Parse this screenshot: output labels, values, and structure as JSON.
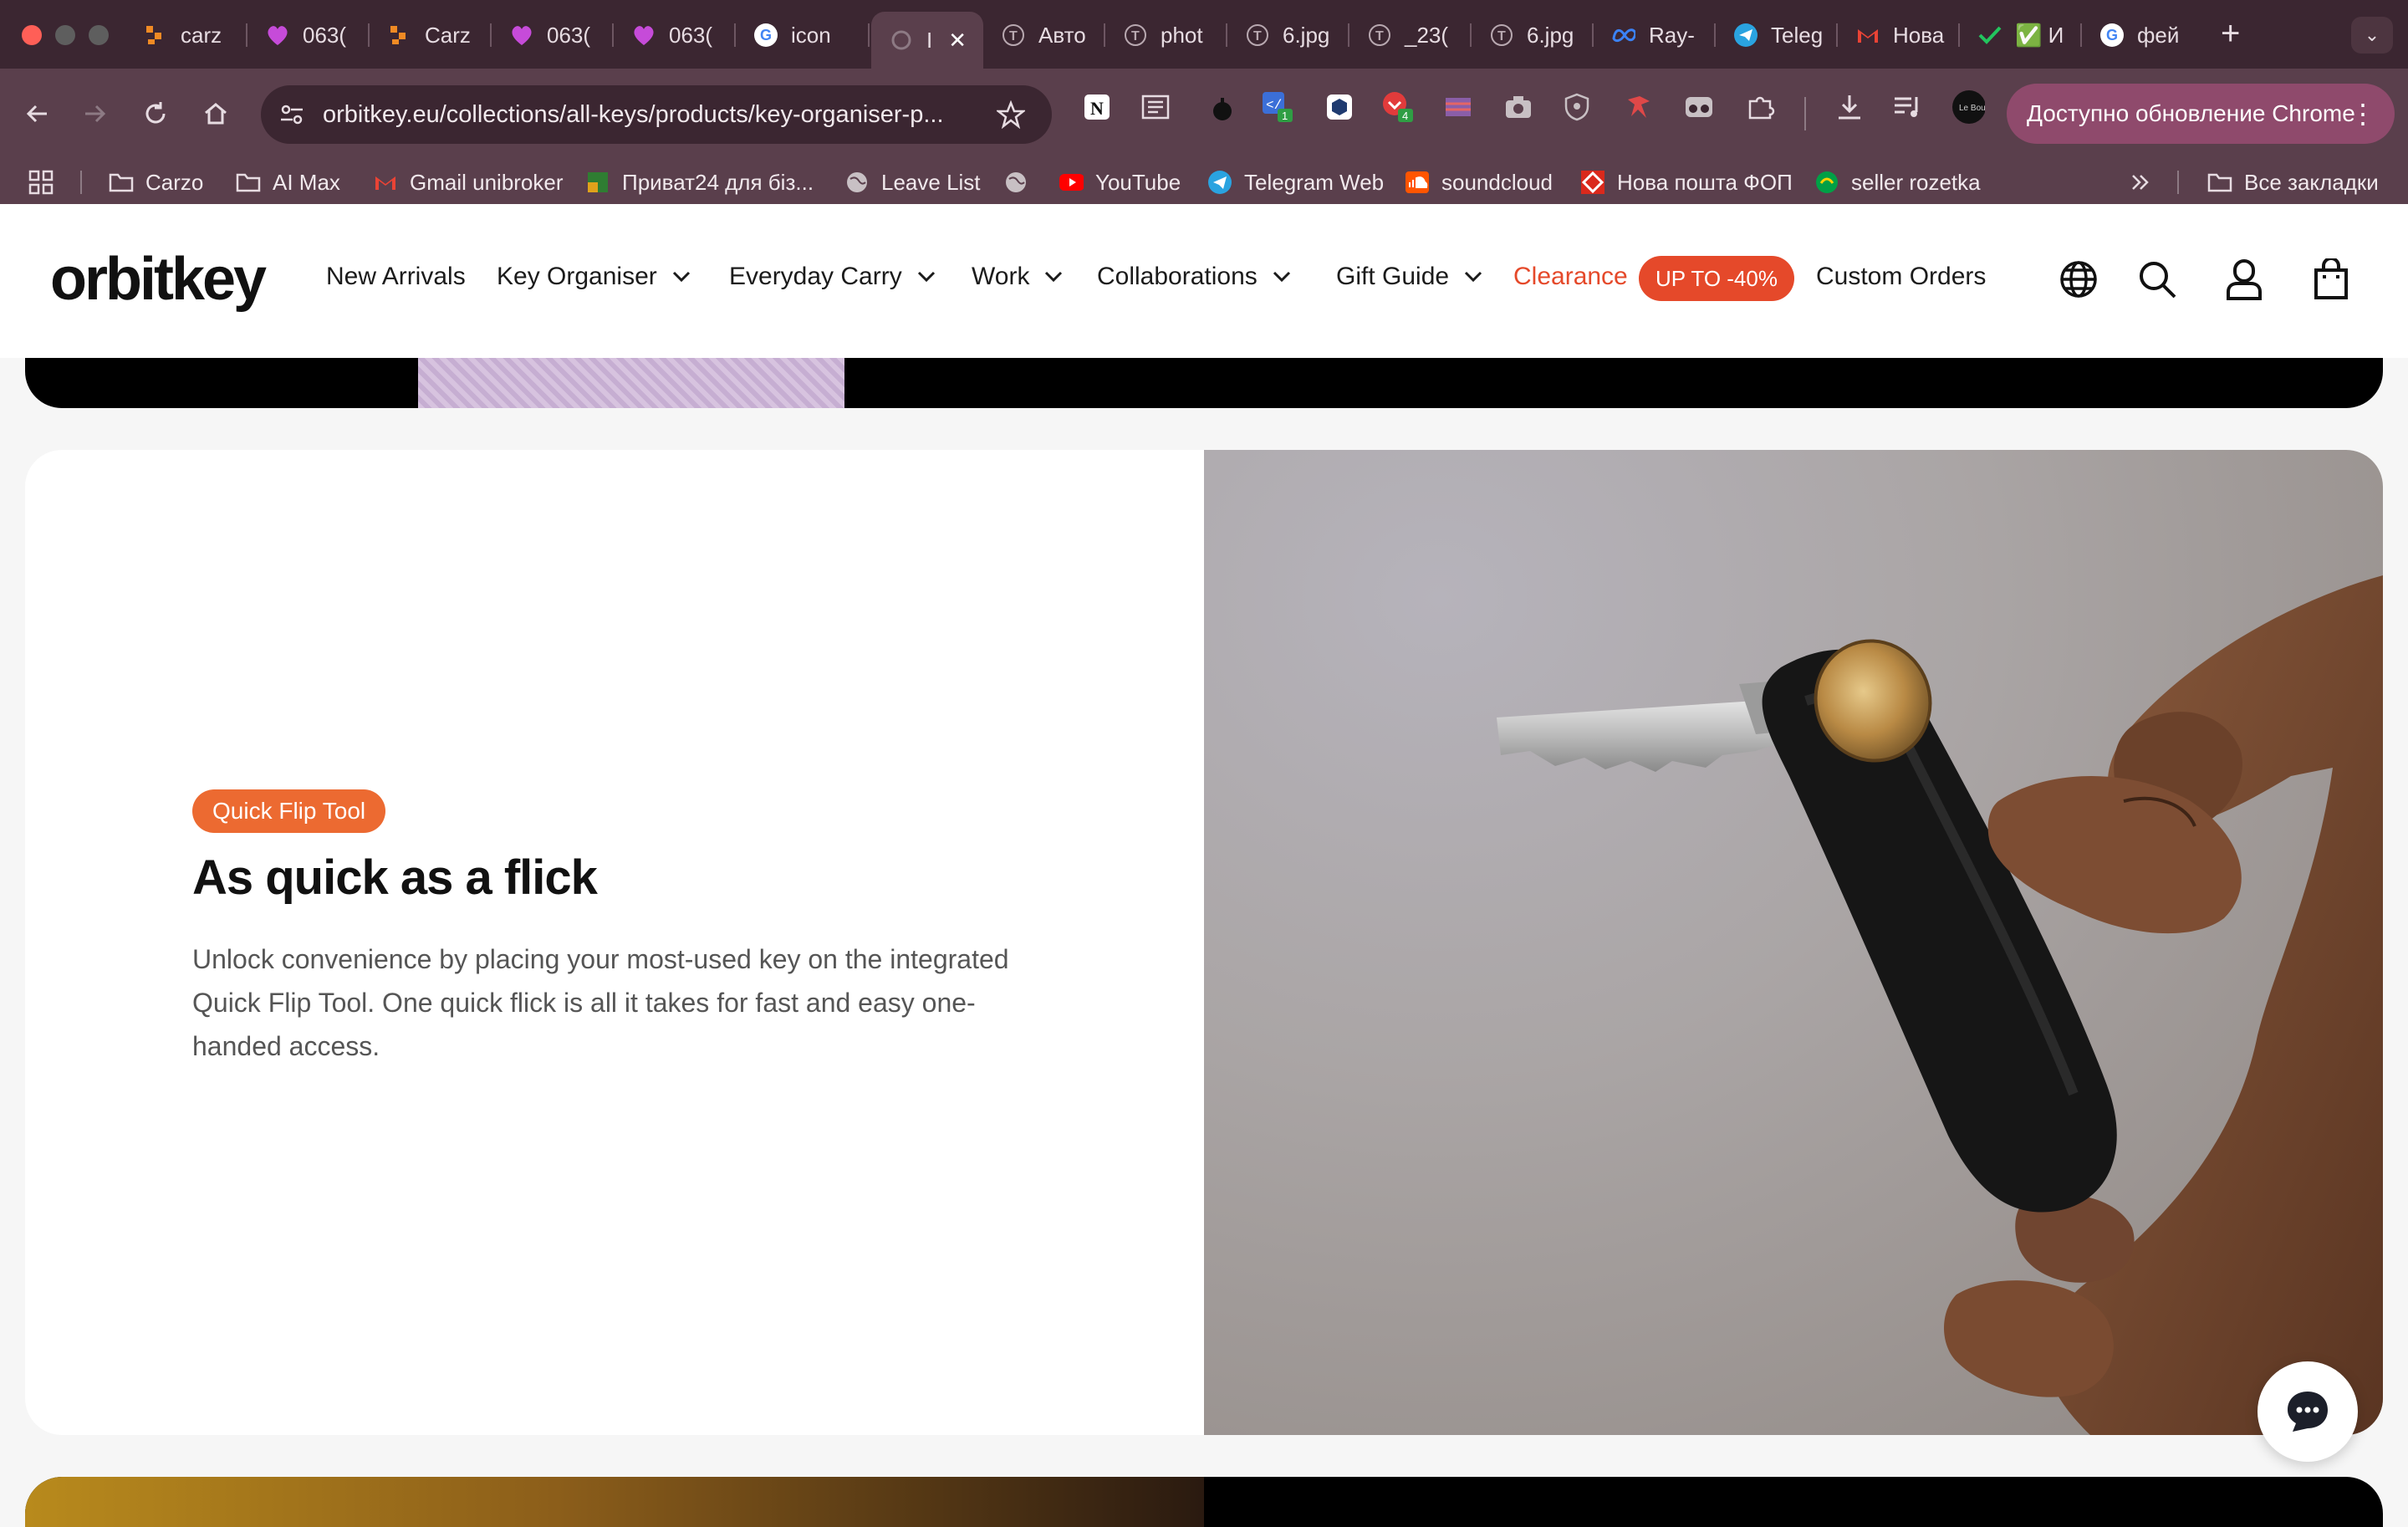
{
  "browser": {
    "tabs": [
      {
        "title": "carz",
        "icon": "carzo-icon"
      },
      {
        "title": "063(",
        "icon": "heart-icon"
      },
      {
        "title": "Carz",
        "icon": "carzo-icon"
      },
      {
        "title": "063(",
        "icon": "heart-icon"
      },
      {
        "title": "063(",
        "icon": "heart-icon"
      },
      {
        "title": "icon",
        "icon": "google-icon"
      },
      {
        "title": "I",
        "icon": "loading-icon",
        "active": true
      },
      {
        "title": "Авто",
        "icon": "t-icon"
      },
      {
        "title": "phot",
        "icon": "t-icon"
      },
      {
        "title": "6.jpg",
        "icon": "t-icon"
      },
      {
        "title": "_23(",
        "icon": "t-icon"
      },
      {
        "title": "6.jpg",
        "icon": "t-icon"
      },
      {
        "title": "Ray-",
        "icon": "meta-icon"
      },
      {
        "title": "Teleg",
        "icon": "telegram-icon"
      },
      {
        "title": "Нова",
        "icon": "gmail-icon"
      },
      {
        "title": "✅ И",
        "icon": "check-icon"
      },
      {
        "title": "фей",
        "icon": "google-icon"
      }
    ],
    "url": "orbitkey.eu/collections/all-keys/products/key-organiser-p...",
    "update_label": "Доступно обновление Chrome",
    "extension_badges": {
      "b1": "1",
      "b2": "4"
    },
    "bookmarks": [
      {
        "label": "Carzo",
        "icon": "folder-icon"
      },
      {
        "label": "AI Max",
        "icon": "folder-icon"
      },
      {
        "label": "Gmail unibroker",
        "icon": "gmail-icon"
      },
      {
        "label": "Приват24 для біз...",
        "icon": "privat-icon"
      },
      {
        "label": "Leave List",
        "icon": "globe-icon"
      },
      {
        "label": "",
        "icon": "globe-icon"
      },
      {
        "label": "YouTube",
        "icon": "youtube-icon"
      },
      {
        "label": "Telegram Web",
        "icon": "telegram-icon"
      },
      {
        "label": "soundcloud",
        "icon": "soundcloud-icon"
      },
      {
        "label": "Нова пошта ФОП",
        "icon": "novaposhta-icon"
      },
      {
        "label": "seller rozetka",
        "icon": "rozetka-icon"
      }
    ],
    "all_bookmarks_label": "Все закладки"
  },
  "site": {
    "logo": "orbitkey",
    "nav": {
      "new_arrivals": "New Arrivals",
      "key_organiser": "Key Organiser",
      "everyday_carry": "Everyday Carry",
      "work": "Work",
      "collaborations": "Collaborations",
      "gift_guide": "Gift Guide",
      "clearance": "Clearance",
      "clearance_badge": "UP TO -40%",
      "custom_orders": "Custom Orders"
    }
  },
  "feature": {
    "tag": "Quick Flip Tool",
    "title": "As quick as a flick",
    "body": "Unlock convenience by placing your most-used key on the integrated Quick Flip Tool. One quick flick is all it takes for fast and easy one-handed access."
  },
  "colors": {
    "browser_frame": "#3b2631",
    "toolbar": "#5a3f4c",
    "accent_orange": "#ec6a31",
    "clearance_red": "#e5492a"
  }
}
